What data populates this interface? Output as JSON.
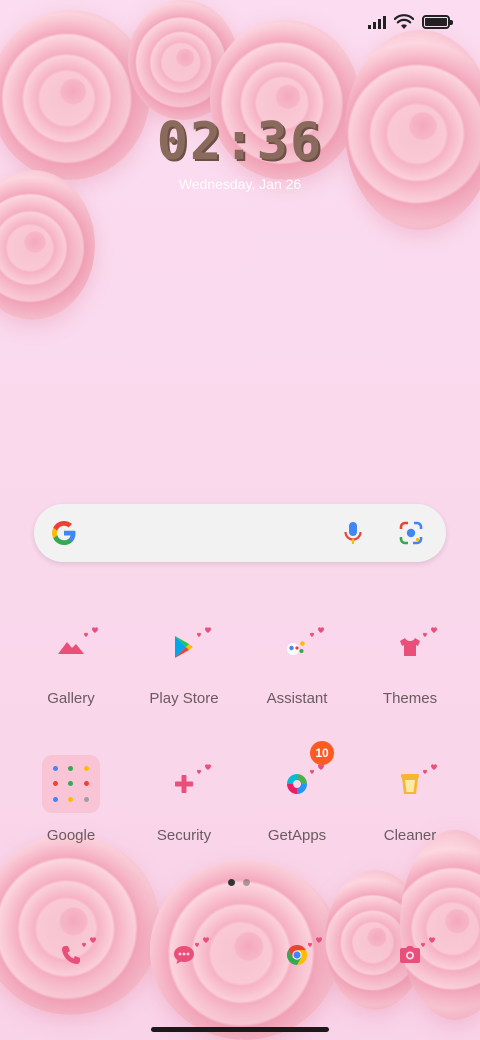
{
  "clock": {
    "time": "02:36",
    "date": "Wednesday, Jan 26"
  },
  "status": {
    "battery_level": 1.0,
    "signal_bars": 4
  },
  "search": {
    "logo_icon": "google-g-icon",
    "mic_icon": "mic-icon",
    "lens_icon": "lens-icon"
  },
  "apps_row1": [
    {
      "label": "Gallery",
      "icon": "gallery-icon"
    },
    {
      "label": "Play Store",
      "icon": "play-store-icon"
    },
    {
      "label": "Assistant",
      "icon": "assistant-icon"
    },
    {
      "label": "Themes",
      "icon": "themes-icon"
    }
  ],
  "apps_row2": [
    {
      "label": "Google",
      "icon": "folder-icon"
    },
    {
      "label": "Security",
      "icon": "security-icon"
    },
    {
      "label": "GetApps",
      "icon": "getapps-icon",
      "badge": "10"
    },
    {
      "label": "Cleaner",
      "icon": "cleaner-icon"
    }
  ],
  "dock": [
    {
      "icon": "phone-icon"
    },
    {
      "icon": "messages-icon"
    },
    {
      "icon": "chrome-icon"
    },
    {
      "icon": "camera-icon"
    }
  ],
  "pager": {
    "pages": 2,
    "current": 1
  },
  "colors": {
    "accent_pink": "#e8507a",
    "badge": "#ff5a1f",
    "label": "#6a5a60",
    "clock": "#8a6a5c"
  }
}
